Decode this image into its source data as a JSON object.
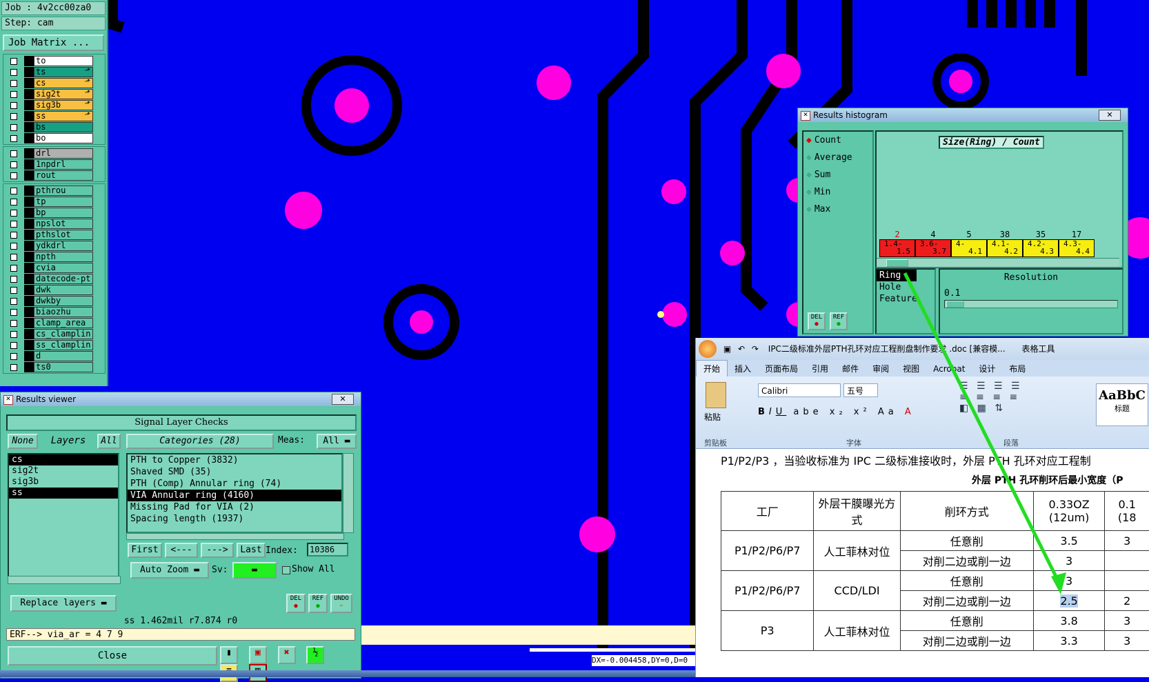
{
  "left_panel": {
    "job": "Job : 4v2cc00za0",
    "step": "Step: cam",
    "job_matrix_button": "Job Matrix ...",
    "layers": [
      {
        "name": "to",
        "bg": "#ffffff",
        "mark": ""
      },
      {
        "name": "ts",
        "bg": "#16a084",
        "mark": "⬏"
      },
      {
        "name": "cs",
        "bg": "#f8c040",
        "mark": "⬏"
      },
      {
        "name": "sig2t",
        "bg": "#f8c040",
        "mark": "⬏"
      },
      {
        "name": "sig3b",
        "bg": "#f8c040",
        "mark": "⬏"
      },
      {
        "name": "ss",
        "bg": "#f8c040",
        "mark": "⬏"
      },
      {
        "name": "bs",
        "bg": "#16a084",
        "mark": ""
      },
      {
        "name": "bo",
        "bg": "#ffffff",
        "mark": ""
      }
    ],
    "drill_layers": [
      "drl",
      "1npdrl",
      "rout"
    ],
    "misc_layers": [
      "pthrou",
      "tp",
      "bp",
      "npslot",
      "pthslot",
      "ydkdrl",
      "npth",
      "cvia",
      "datecode-pt",
      "dwk",
      "dwkby",
      "biaozhu",
      "clamp_area",
      "cs_clamplin",
      "ss_clamplin",
      "d",
      "ts0"
    ]
  },
  "results_viewer": {
    "title": "Results viewer",
    "header": "Signal Layer Checks",
    "none_btn": "None",
    "layers_label": "Layers",
    "all_btn": "All",
    "categories_label": "Categories (28)",
    "meas_label": "Meas:",
    "meas_value": "All",
    "layer_list": [
      "cs",
      "sig2t",
      "sig3b",
      "ss"
    ],
    "categories": [
      "PTH to Copper (3832)",
      "Shaved SMD (35)",
      "PTH (Comp) Annular ring (74)",
      "VIA Annular ring (4160)",
      "Missing Pad for VIA (2)",
      "Spacing length (1937)"
    ],
    "first_btn": "First",
    "prev_btn": "<---",
    "next_btn": "--->",
    "last_btn": "Last",
    "index_label": "Index:",
    "index_value": "10386",
    "auto_zoom": "Auto Zoom",
    "sv_label": "Sv:",
    "show_all": "Show All",
    "replace_layers": "Replace layers",
    "del_btn": "DEL",
    "ref_btn": "REF",
    "undo_btn": "UNDO",
    "status": "ss 1.462mil  r7.874  r0",
    "erf": "ERF--> via_ar = 4 7 9",
    "close": "Close"
  },
  "histogram": {
    "title": "Results histogram",
    "modes": [
      "Count",
      "Average",
      "Sum",
      "Min",
      "Max"
    ],
    "chart_title": "Size(Ring) / Count",
    "bins": [
      {
        "count": "2",
        "label1": "1.4-",
        "label2": "1.5",
        "color": "#ee1c1c"
      },
      {
        "count": "4",
        "label1": "3.6-",
        "label2": "3.7",
        "color": "#ee1c1c"
      },
      {
        "count": "5",
        "label1": "4-",
        "label2": "4.1",
        "color": "#f6ee10"
      },
      {
        "count": "38",
        "label1": "4.1-",
        "label2": "4.2",
        "color": "#f6ee10"
      },
      {
        "count": "35",
        "label1": "4.2-",
        "label2": "4.3",
        "color": "#f6ee10"
      },
      {
        "count": "17",
        "label1": "4.3-",
        "label2": "4.4",
        "color": "#f6ee10"
      }
    ],
    "types": [
      "Ring",
      "Hole",
      "Feature"
    ],
    "resolution_label": "Resolution",
    "resolution_value": "0.1",
    "del_btn": "DEL",
    "ref_btn": "REF"
  },
  "status_bar": {
    "coords": "DX=-0.004458,DY=0,D=0"
  },
  "word": {
    "title": "IPC二级标准外层PTH孔环对应工程削盘制作要求 .doc [兼容模...",
    "table_tools": "表格工具",
    "tabs": [
      "开始",
      "插入",
      "页面布局",
      "引用",
      "邮件",
      "审阅",
      "视图",
      "Acrobat",
      "设计",
      "布局"
    ],
    "paste": "粘贴",
    "clipboard": "剪贴板",
    "font_name": "Calibri",
    "font_size": "五号",
    "font_group": "字体",
    "para_group": "段落",
    "style_preview": "AaBbC",
    "style_name": "标题",
    "paragraph_text": "P1/P2/P3 ，当验收标准为 IPC 二级标准接收时，外层 PTH 孔环对应工程制",
    "table_caption": "外层 PTH 孔环削环后最小宽度（P",
    "table_header": [
      "工厂",
      "外层干膜曝光方式",
      "削环方式",
      "0.33OZ (12um)",
      "0.1 (18"
    ],
    "rows": [
      {
        "factory": "P1/P2/P6/P7",
        "method": "人工菲林对位",
        "cut": "任意削",
        "v1": "3.5",
        "v2": "3"
      },
      {
        "factory": "",
        "method": "",
        "cut": "对削二边或削一边",
        "v1": "3",
        "v2": ""
      },
      {
        "factory": "P1/P2/P6/P7",
        "method": "CCD/LDI",
        "cut": "任意削",
        "v1": "3",
        "v2": ""
      },
      {
        "factory": "",
        "method": "",
        "cut": "对削二边或削一边",
        "v1": "2.5",
        "v2": "2"
      },
      {
        "factory": "P3",
        "method": "人工菲林对位",
        "cut": "任意削",
        "v1": "3.8",
        "v2": "3"
      },
      {
        "factory": "",
        "method": "",
        "cut": "对削二边或削一边",
        "v1": "3.3",
        "v2": "3"
      }
    ]
  },
  "colors": {
    "board": "#0000f0",
    "pad": "#ff00e0",
    "panel": "#5ec8a8",
    "arrow": "#22dd22"
  }
}
